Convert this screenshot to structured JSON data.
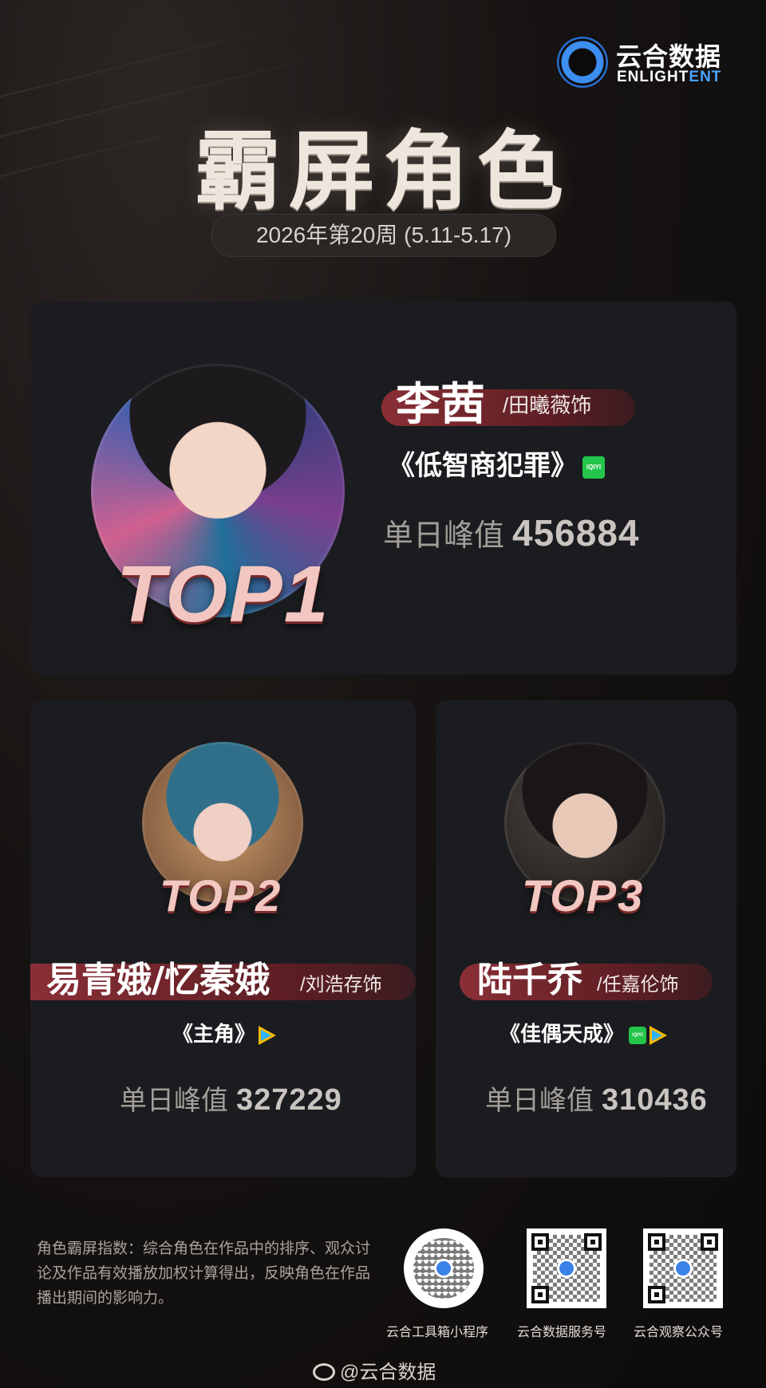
{
  "brand": {
    "name_cn": "云合数据",
    "name_en_main": "ENLIGHT",
    "name_en_accent": "ENT"
  },
  "title": "霸屏角色",
  "period": "2026年第20周 (5.11-5.17)",
  "entries": [
    {
      "rank": "TOP1",
      "character": "李茜",
      "actor": "/田曦薇饰",
      "work": "《低智商犯罪》",
      "platforms": [
        "iqiyi"
      ],
      "peak_label": "单日峰值",
      "peak_value": "456884"
    },
    {
      "rank": "TOP2",
      "character": "易青娥/忆秦娥",
      "actor": "/刘浩存饰",
      "work": "《主角》",
      "platforms": [
        "tencent-video"
      ],
      "peak_label": "单日峰值",
      "peak_value": "327229"
    },
    {
      "rank": "TOP3",
      "character": "陆千乔",
      "actor": "/任嘉伦饰",
      "work": "《佳偶天成》",
      "platforms": [
        "iqiyi",
        "tencent-video"
      ],
      "peak_label": "单日峰值",
      "peak_value": "310436"
    }
  ],
  "platform_badge_text": {
    "iqiyi": "iQIYI"
  },
  "footer": {
    "note": "角色霸屏指数：综合角色在作品中的排序、观众讨论及作品有效播放加权计算得出，反映角色在作品播出期间的影响力。",
    "qr_labels": [
      "云合工具箱小程序",
      "云合数据服务号",
      "云合观察公众号"
    ],
    "weibo_handle": "@云合数据"
  },
  "colors": {
    "background": "#0d0b0b",
    "card": "#1b1c1f",
    "accent_red": "#8a2f36",
    "brand_blue": "#3c8ef0"
  }
}
